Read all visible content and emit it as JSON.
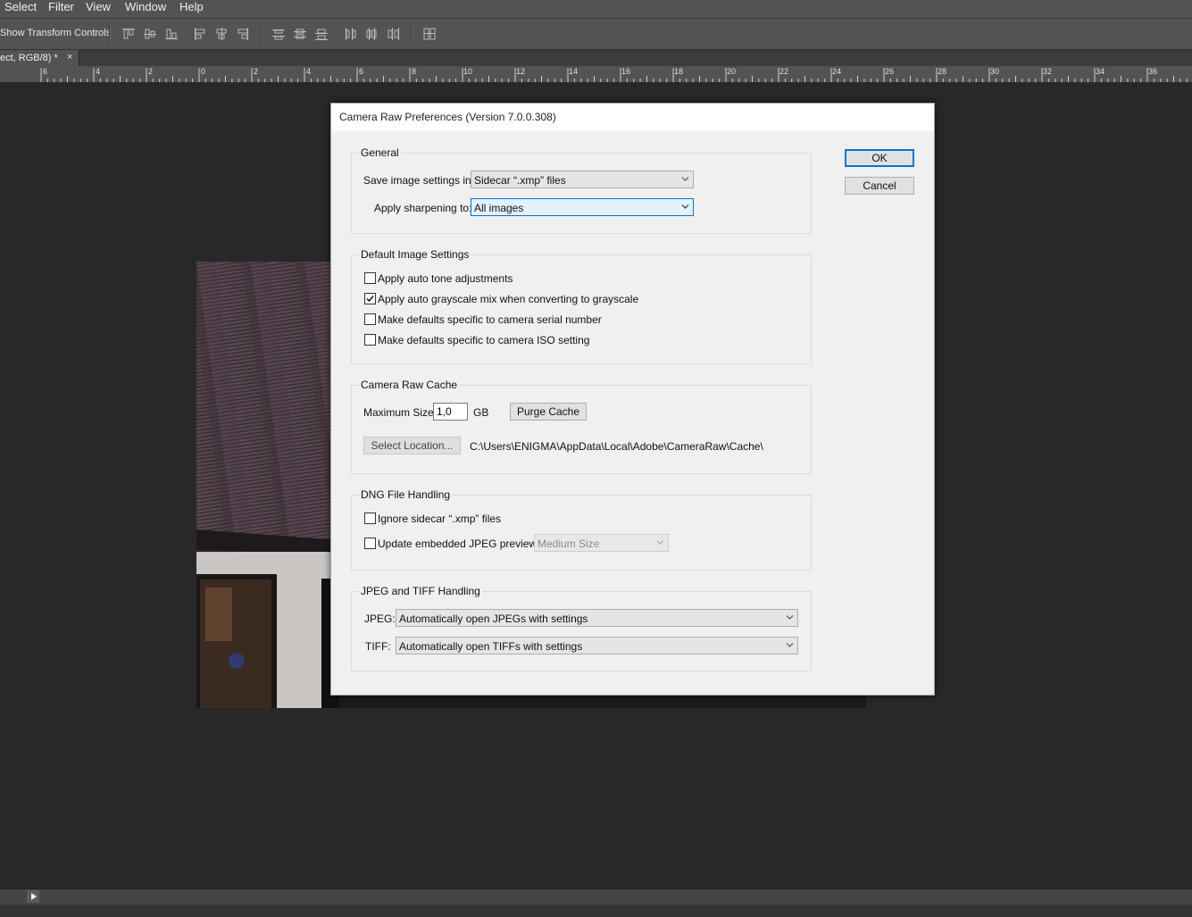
{
  "menubar": {
    "items": [
      "Select",
      "Filter",
      "View",
      "Window",
      "Help"
    ]
  },
  "optionsbar": {
    "transform_label": "Show Transform Controls"
  },
  "document_tab": {
    "title": "ect, RGB/8) *",
    "close": "×"
  },
  "ruler": {
    "labels": [
      "6",
      "4",
      "2",
      "0",
      "2",
      "4",
      "6",
      "8",
      "10",
      "12",
      "14",
      "16",
      "18",
      "20",
      "22",
      "24",
      "26",
      "28",
      "30",
      "32",
      "34",
      "36"
    ]
  },
  "dialog": {
    "title": "Camera Raw Preferences  (Version 7.0.0.308)",
    "ok_label": "OK",
    "cancel_label": "Cancel",
    "general": {
      "legend": "General",
      "save_label": "Save image settings in:",
      "save_value": "Sidecar “.xmp” files",
      "sharpen_label": "Apply sharpening to:",
      "sharpen_value": "All images"
    },
    "defaults": {
      "legend": "Default Image Settings",
      "options": [
        {
          "label": "Apply auto tone adjustments",
          "checked": false
        },
        {
          "label": "Apply auto grayscale mix when converting to grayscale",
          "checked": true
        },
        {
          "label": "Make defaults specific to camera serial number",
          "checked": false
        },
        {
          "label": "Make defaults specific to camera ISO setting",
          "checked": false
        }
      ]
    },
    "cache": {
      "legend": "Camera Raw Cache",
      "max_size_label": "Maximum Size:",
      "max_size_value": "1,0",
      "unit": "GB",
      "purge_label": "Purge Cache",
      "select_location_label": "Select Location...",
      "path": "C:\\Users\\ENIGMA\\AppData\\Local\\Adobe\\CameraRaw\\Cache\\"
    },
    "dng": {
      "legend": "DNG File Handling",
      "ignore_label": "Ignore sidecar “.xmp” files",
      "ignore_checked": false,
      "update_label": "Update embedded JPEG previews:",
      "update_checked": false,
      "update_value": "Medium Size"
    },
    "jpeg_tiff": {
      "legend": "JPEG and TIFF Handling",
      "jpeg_label": "JPEG:",
      "jpeg_value": "Automatically open JPEGs with settings",
      "tiff_label": "TIFF:",
      "tiff_value": "Automatically open TIFFs with settings"
    }
  },
  "colors": {
    "accent": "#0078d7",
    "chrome": "#535353",
    "canvas": "#282828",
    "dialog_bg": "#f0f0f0"
  }
}
